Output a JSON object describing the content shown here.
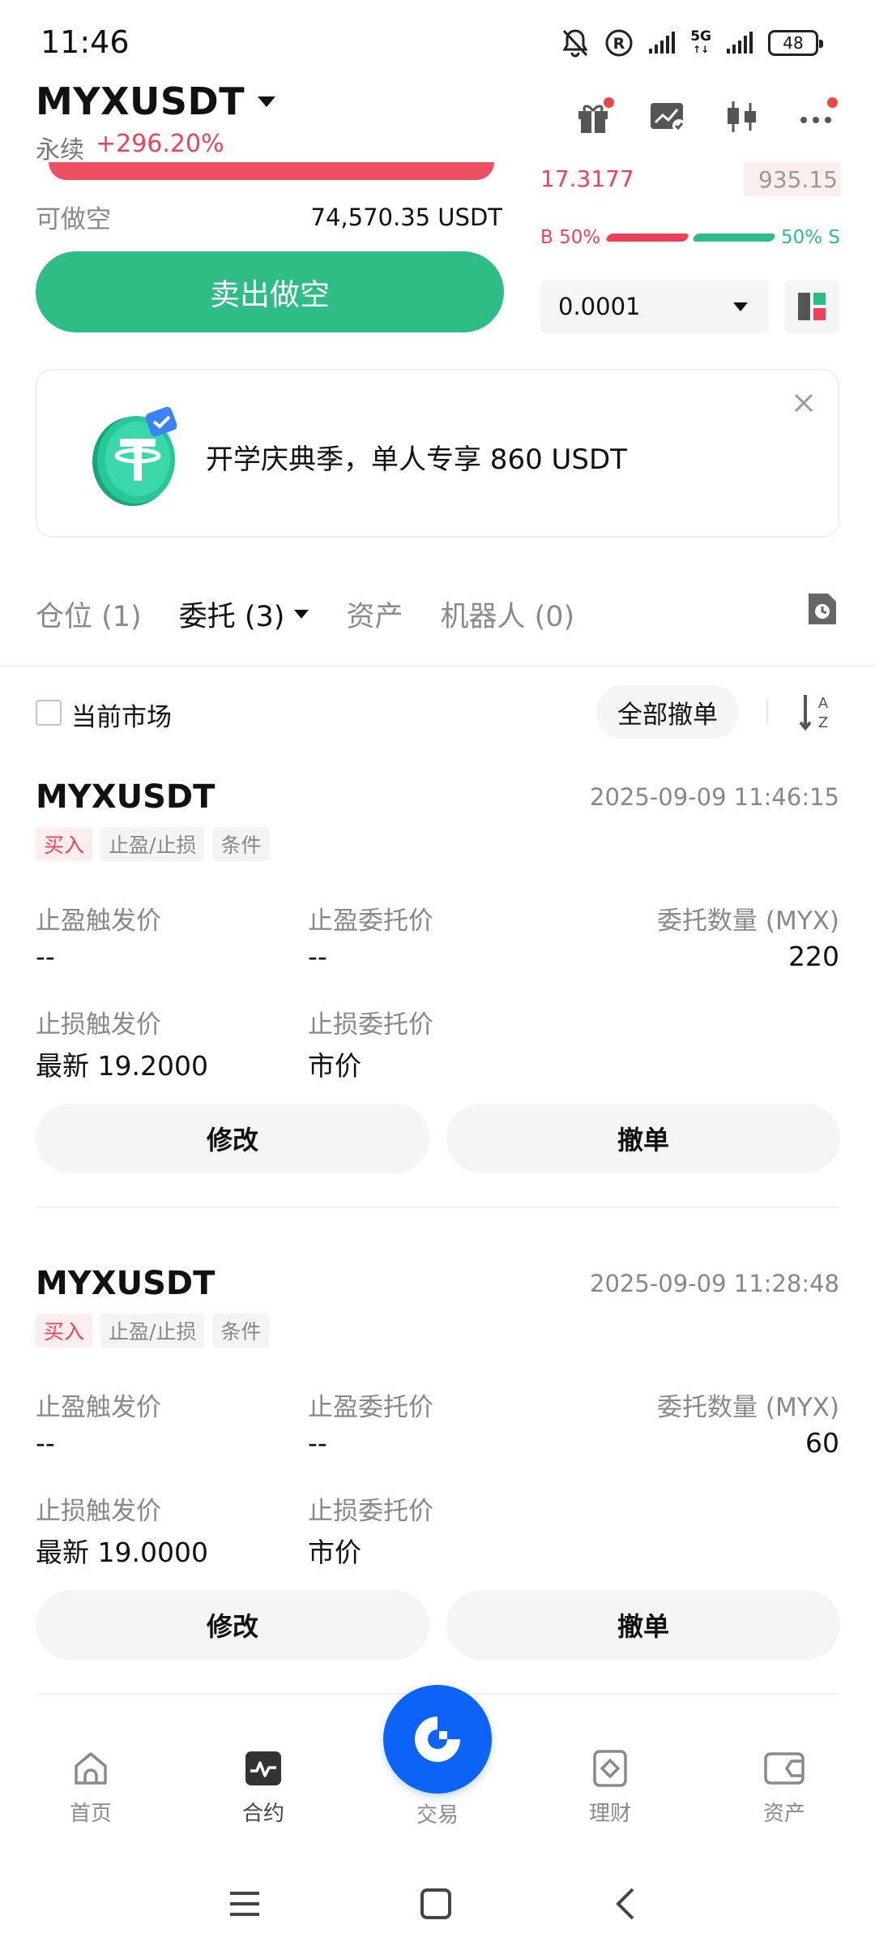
{
  "status_bar": {
    "time": "11:46",
    "network": "5G",
    "network_sub": "↑↓",
    "battery": "48",
    "icons": [
      "bell-muted-icon",
      "r-circle-icon",
      "signal-icon",
      "signal-5g-icon",
      "battery-icon"
    ]
  },
  "header": {
    "pair": "MYXUSDT",
    "type": "永续",
    "change": "+296.20%",
    "actions": [
      "gift-icon",
      "chart-check-icon",
      "candlestick-icon",
      "more-icon"
    ]
  },
  "trade": {
    "short_label": "可做空",
    "short_value": "74,570.35 USDT",
    "sell_button": "卖出做空",
    "orderbook_price": "17.3177",
    "orderbook_qty": "935.15",
    "buy_ratio_label": "B 50%",
    "sell_ratio_label": "50% S",
    "buy_ratio": 0.5,
    "precision": "0.0001"
  },
  "banner": {
    "text": "开学庆典季，单人专享 860 USDT",
    "logo": "tether-coin-icon"
  },
  "tabs": {
    "positions": "仓位 (1)",
    "orders": "委托 (3)",
    "assets": "资产",
    "robots": "机器人 (0)"
  },
  "filter": {
    "current_market": "当前市场",
    "cancel_all": "全部撤单"
  },
  "orders": [
    {
      "symbol": "MYXUSDT",
      "time": "2025-09-09 11:46:15",
      "tags": [
        "买入",
        "止盈/止损",
        "条件"
      ],
      "tp_trigger_label": "止盈触发价",
      "tp_trigger": "--",
      "tp_order_label": "止盈委托价",
      "tp_order": "--",
      "qty_label": "委托数量 (MYX)",
      "qty": "220",
      "sl_trigger_label": "止损触发价",
      "sl_trigger": "最新 19.2000",
      "sl_order_label": "止损委托价",
      "sl_order": "市价",
      "modify": "修改",
      "cancel": "撤单"
    },
    {
      "symbol": "MYXUSDT",
      "time": "2025-09-09 11:28:48",
      "tags": [
        "买入",
        "止盈/止损",
        "条件"
      ],
      "tp_trigger_label": "止盈触发价",
      "tp_trigger": "--",
      "tp_order_label": "止盈委托价",
      "tp_order": "--",
      "qty_label": "委托数量 (MYX)",
      "qty": "60",
      "sl_trigger_label": "止损触发价",
      "sl_trigger": "最新 19.0000",
      "sl_order_label": "止损委托价",
      "sl_order": "市价",
      "modify": "修改",
      "cancel": "撤单"
    }
  ],
  "bottom_nav": {
    "home": "首页",
    "contract": "合约",
    "trade": "交易",
    "finance": "理财",
    "assets": "资产"
  },
  "colors": {
    "green": "#2ebd85",
    "red": "#e94359",
    "blue": "#0c63f5"
  }
}
